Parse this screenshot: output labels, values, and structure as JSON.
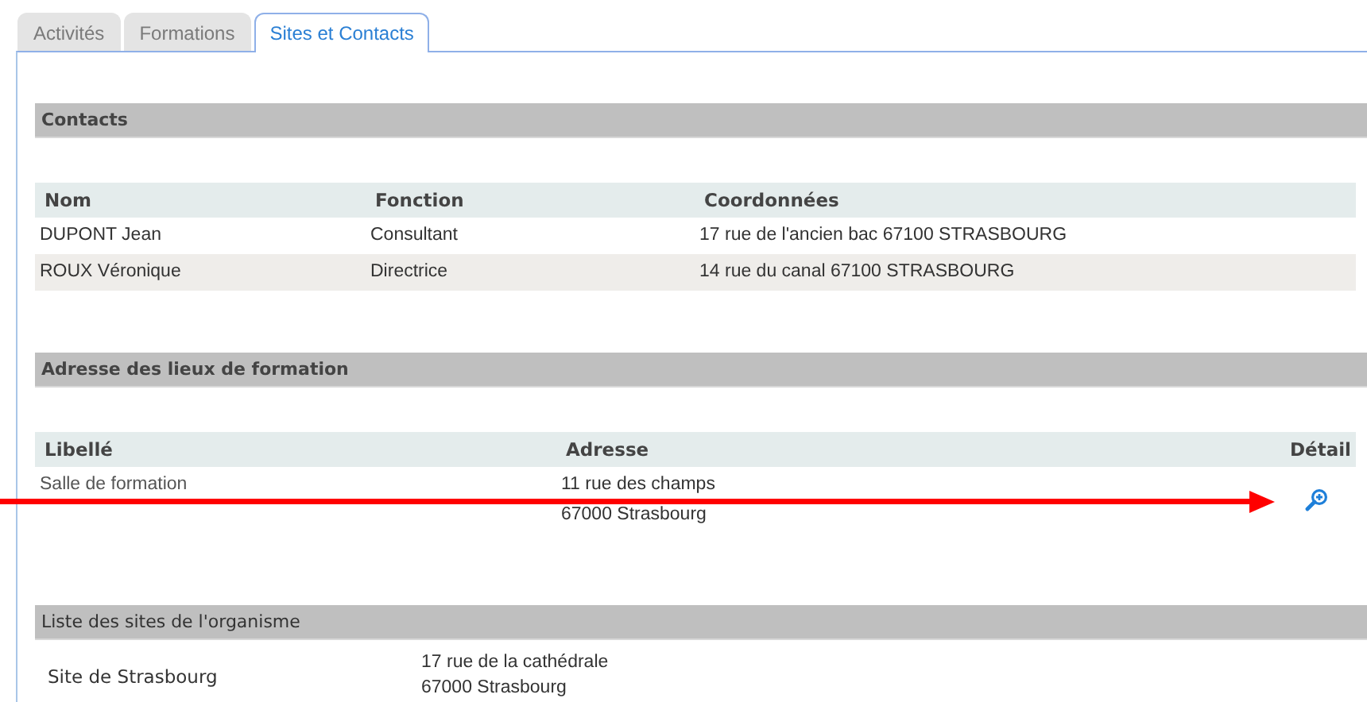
{
  "tabs": [
    {
      "label": "Activités",
      "selected": false
    },
    {
      "label": "Formations",
      "selected": false
    },
    {
      "label": "Sites et Contacts",
      "selected": true
    }
  ],
  "contacts": {
    "title": "Contacts",
    "columns": [
      "Nom",
      "Fonction",
      "Coordonnées"
    ],
    "rows": [
      [
        "DUPONT Jean",
        "Consultant",
        "17 rue de l'ancien bac 67100 STRASBOURG"
      ],
      [
        "ROUX Véronique",
        "Directrice",
        "14 rue du canal 67100 STRASBOURG"
      ]
    ]
  },
  "training_places": {
    "title": "Adresse des lieux de formation",
    "columns": [
      "Libellé",
      "Adresse",
      "Détail"
    ],
    "rows": [
      {
        "label": "Salle de formation",
        "address": [
          "11 rue des champs",
          "67000 Strasbourg"
        ]
      }
    ]
  },
  "sites": {
    "title": "Liste des sites de l'organisme",
    "rows": [
      {
        "name": "Site de Strasbourg",
        "address": [
          "17 rue de la cathédrale",
          "67000 Strasbourg"
        ]
      }
    ]
  }
}
